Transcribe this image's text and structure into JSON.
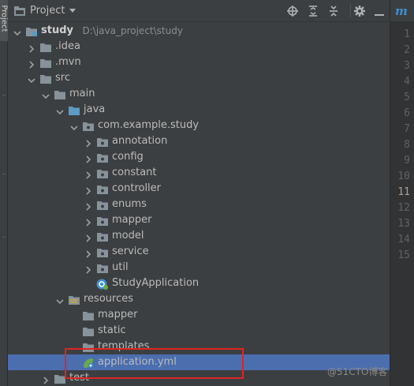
{
  "tool_strip": {
    "tab_label": "Project"
  },
  "panel": {
    "title": "Project",
    "buttons": [
      "locate-icon",
      "expand-all-icon",
      "collapse-all-icon",
      "settings-icon",
      "hide-icon"
    ]
  },
  "tree": [
    {
      "label": "study",
      "path": "D:\\java_project\\study",
      "depth": 0,
      "chevron": "down",
      "icon": "module-folder",
      "bold": true
    },
    {
      "label": ".idea",
      "depth": 1,
      "chevron": "right",
      "icon": "folder"
    },
    {
      "label": ".mvn",
      "depth": 1,
      "chevron": "right",
      "icon": "folder"
    },
    {
      "label": "src",
      "depth": 1,
      "chevron": "down",
      "icon": "folder"
    },
    {
      "label": "main",
      "depth": 2,
      "chevron": "down",
      "icon": "folder"
    },
    {
      "label": "java",
      "depth": 3,
      "chevron": "down",
      "icon": "source-folder"
    },
    {
      "label": "com.example.study",
      "depth": 4,
      "chevron": "down",
      "icon": "package"
    },
    {
      "label": "annotation",
      "depth": 5,
      "chevron": "right",
      "icon": "package"
    },
    {
      "label": "config",
      "depth": 5,
      "chevron": "right",
      "icon": "package"
    },
    {
      "label": "constant",
      "depth": 5,
      "chevron": "right",
      "icon": "package"
    },
    {
      "label": "controller",
      "depth": 5,
      "chevron": "right",
      "icon": "package"
    },
    {
      "label": "enums",
      "depth": 5,
      "chevron": "right",
      "icon": "package"
    },
    {
      "label": "mapper",
      "depth": 5,
      "chevron": "right",
      "icon": "package"
    },
    {
      "label": "model",
      "depth": 5,
      "chevron": "right",
      "icon": "package"
    },
    {
      "label": "service",
      "depth": 5,
      "chevron": "right",
      "icon": "package"
    },
    {
      "label": "util",
      "depth": 5,
      "chevron": "right",
      "icon": "package"
    },
    {
      "label": "StudyApplication",
      "depth": 5,
      "chevron": "none",
      "icon": "spring-class"
    },
    {
      "label": "resources",
      "depth": 3,
      "chevron": "down",
      "icon": "resources-folder"
    },
    {
      "label": "mapper",
      "depth": 4,
      "chevron": "none",
      "icon": "folder"
    },
    {
      "label": "static",
      "depth": 4,
      "chevron": "none",
      "icon": "folder"
    },
    {
      "label": "templates",
      "depth": 4,
      "chevron": "none",
      "icon": "folder"
    },
    {
      "label": "application.yml",
      "depth": 4,
      "chevron": "none",
      "icon": "spring-yml",
      "selected": true
    },
    {
      "label": "test",
      "depth": 2,
      "chevron": "right",
      "icon": "folder"
    }
  ],
  "gutter": {
    "tab_icon": "m",
    "line_numbers": [
      "1",
      "2",
      "3",
      "4",
      "5",
      "6",
      "7",
      "8",
      "9",
      "10",
      "11",
      "12",
      "13",
      "14",
      "15"
    ],
    "active_line": "11"
  },
  "watermark": "@51CTO博客",
  "colors": {
    "panel_bg": "#3c3f41",
    "selection": "#4b6eaf",
    "highlight_box": "#e02424",
    "folder": "#87939a",
    "source_folder": "#5c9bc4"
  }
}
